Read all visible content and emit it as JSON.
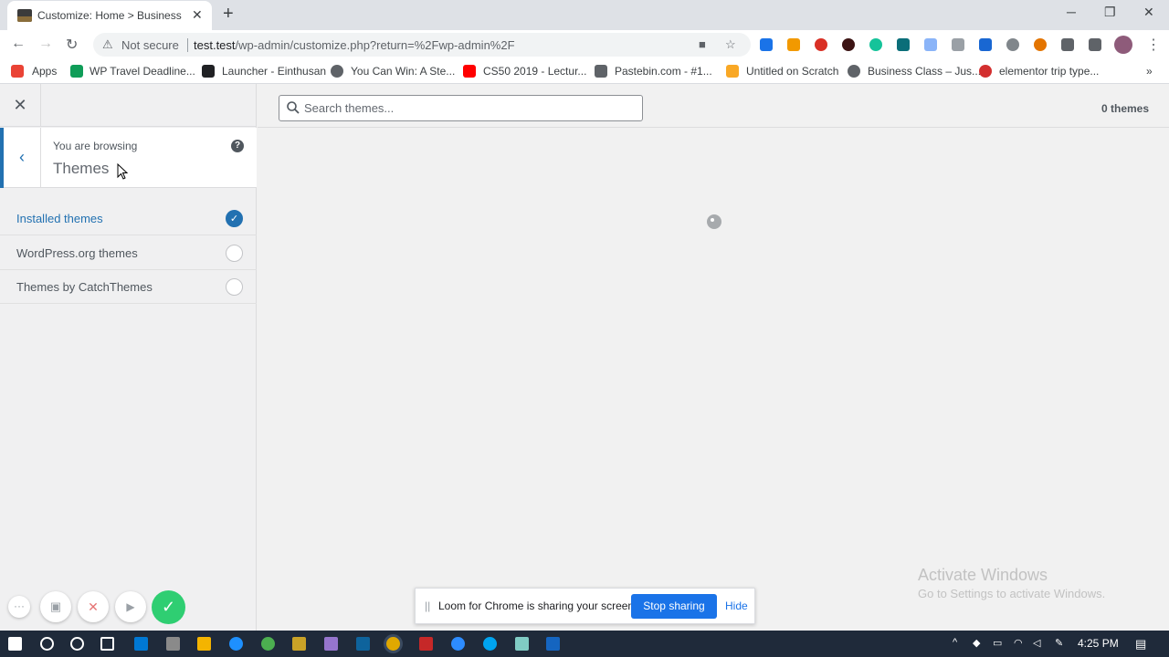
{
  "browser": {
    "tab_title": "Customize: Home > Business",
    "not_secure": "Not secure",
    "url_host": "test.test",
    "url_path": "/wp-admin/customize.php?return=%2Fwp-admin%2F",
    "bookmarks": [
      {
        "label": "Apps",
        "icon_color": "#ea4335"
      },
      {
        "label": "WP Travel Deadline...",
        "icon_color": "#0f9d58"
      },
      {
        "label": "Launcher - Einthusan",
        "icon_color": "#202124"
      },
      {
        "label": "You Can Win: A Ste...",
        "icon_color": "#5f6368"
      },
      {
        "label": "CS50 2019 - Lectur...",
        "icon_color": "#ff0000"
      },
      {
        "label": "Pastebin.com - #1...",
        "icon_color": "#5f6368"
      },
      {
        "label": "Untitled on Scratch",
        "icon_color": "#f9a825"
      },
      {
        "label": "Business Class – Jus...",
        "icon_color": "#5f6368"
      },
      {
        "label": "elementor trip type...",
        "icon_color": "#d32f2f"
      }
    ]
  },
  "customizer": {
    "browsing_label": "You are browsing",
    "browsing_title": "Themes",
    "filters": [
      {
        "label": "Installed themes",
        "selected": true
      },
      {
        "label": "WordPress.org themes",
        "selected": false
      },
      {
        "label": "Themes by CatchThemes",
        "selected": false
      }
    ],
    "search_placeholder": "Search themes...",
    "theme_count": "0 themes"
  },
  "watermark": {
    "title": "Activate Windows",
    "subtitle": "Go to Settings to activate Windows."
  },
  "loom": {
    "share_text": "Loom for Chrome is sharing your screen.",
    "stop_label": "Stop sharing",
    "hide_label": "Hide"
  },
  "taskbar": {
    "time": "4:25 PM"
  },
  "colors": {
    "wp_blue": "#2271b1",
    "loom_green": "#2fce72",
    "chrome_blue": "#1a73e8"
  }
}
